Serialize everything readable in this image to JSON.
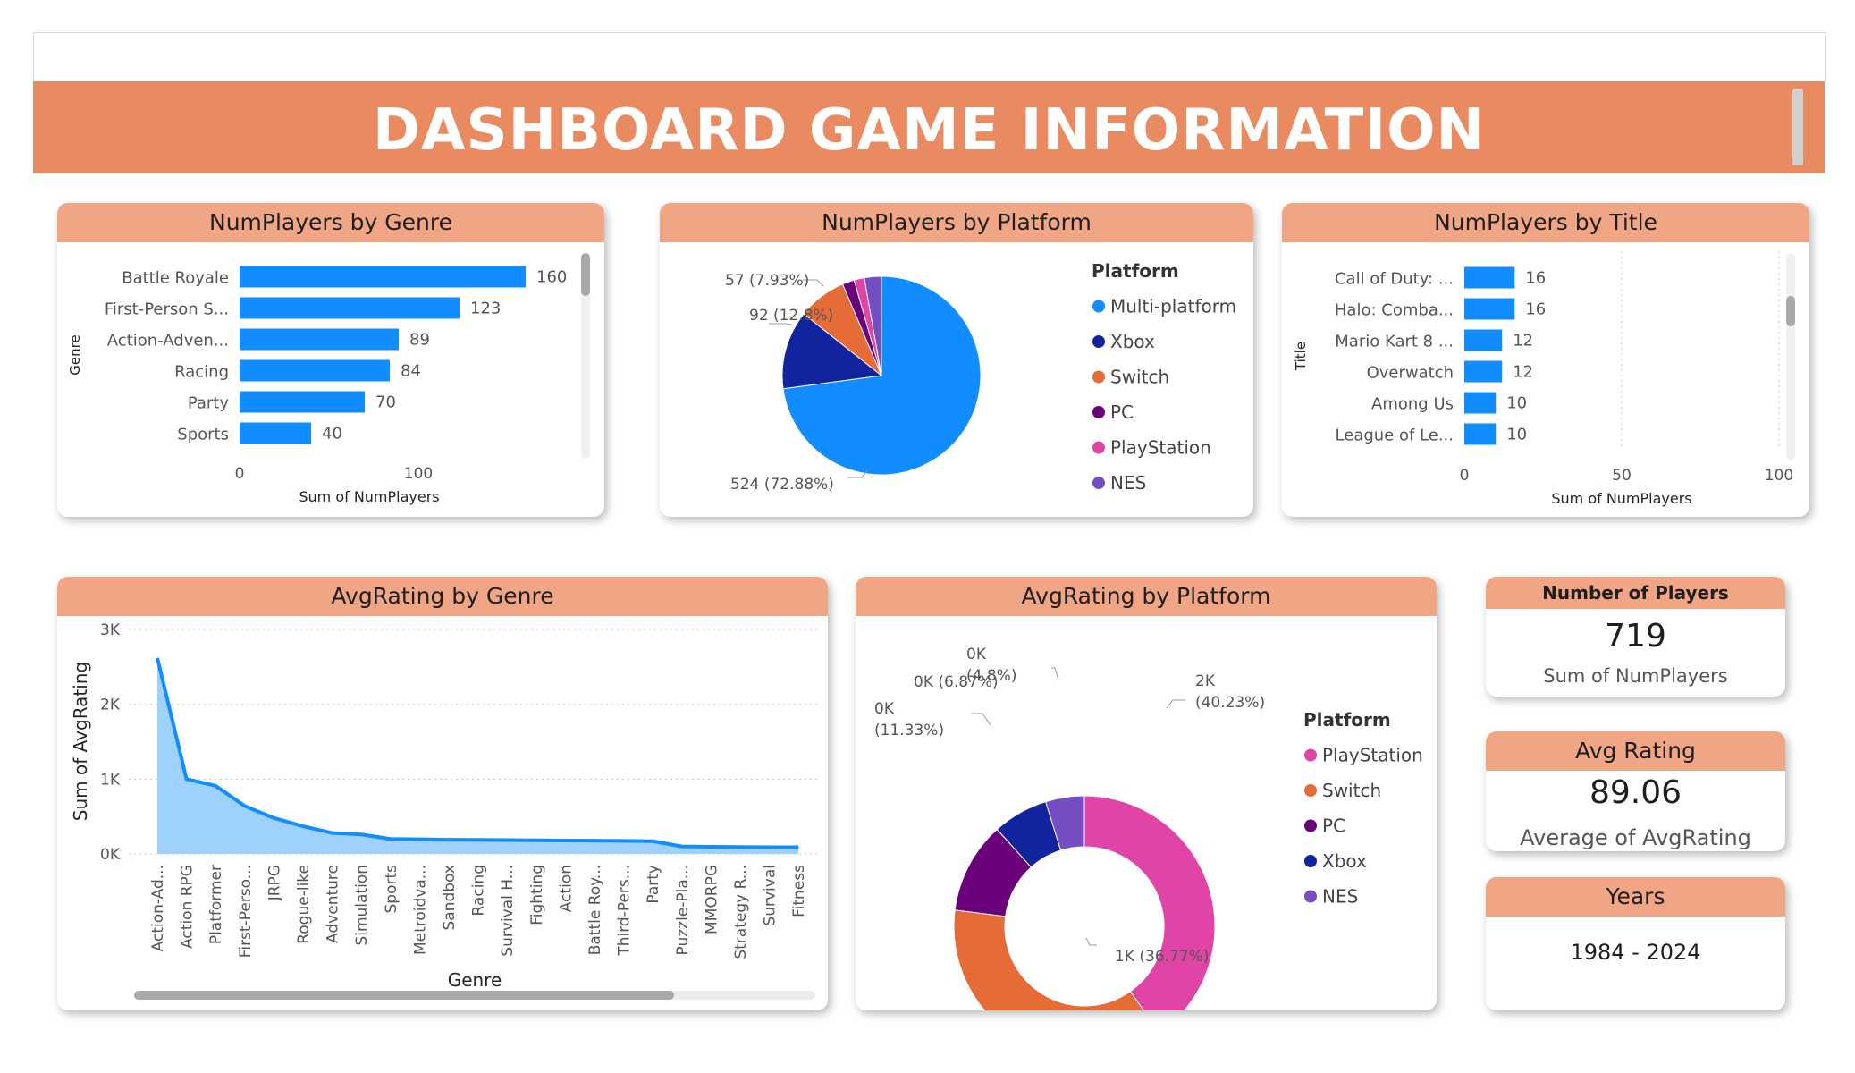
{
  "dashboard": {
    "title": "DASHBOARD GAME INFORMATION"
  },
  "colors": {
    "banner": "#e98a61",
    "card_header": "#f0a585",
    "bar": "#118dff"
  },
  "charts": {
    "genre_bar": {
      "title": "NumPlayers by Genre"
    },
    "platform_pie": {
      "title": "NumPlayers by Platform"
    },
    "title_bar": {
      "title": "NumPlayers by Title"
    },
    "genre_area": {
      "title": "AvgRating by Genre"
    },
    "platform_donut": {
      "title": "AvgRating by Platform"
    }
  },
  "kpis": {
    "players": {
      "title": "Number of Players",
      "value": "719",
      "label": "Sum of NumPlayers"
    },
    "rating": {
      "title": "Avg Rating",
      "value": "89.06",
      "label": "Average of AvgRating"
    },
    "years": {
      "title": "Years",
      "value": "1984 - 2024"
    }
  },
  "chart_data": [
    {
      "type": "bar",
      "orientation": "horizontal",
      "title": "NumPlayers by Genre",
      "categories": [
        "Battle Royale",
        "First-Person S...",
        "Action-Adven...",
        "Racing",
        "Party",
        "Sports"
      ],
      "values": [
        160,
        123,
        89,
        84,
        70,
        40
      ],
      "data_labels": [
        "160",
        "123",
        "89",
        "84",
        "70",
        "40"
      ],
      "xlabel": "Sum of NumPlayers",
      "ylabel": "Genre",
      "xlim": [
        0,
        190
      ],
      "x_ticks": [
        0,
        100
      ],
      "x_tick_labels": [
        "0",
        "100"
      ],
      "color": "#118dff"
    },
    {
      "type": "pie",
      "title": "NumPlayers by Platform",
      "legend_title": "Platform",
      "legend_position": "right",
      "labels": [
        "Multi-platform",
        "Xbox",
        "Switch",
        "PC",
        "PlayStation",
        "NES"
      ],
      "values": [
        524,
        92,
        57,
        14,
        12,
        20
      ],
      "colors": [
        "#118dff",
        "#12239e",
        "#e66c37",
        "#6b007b",
        "#e044a7",
        "#744ec2"
      ],
      "data_labels": [
        "524 (72.88%)",
        "92 (12.8%)",
        "57 (7.93%)",
        "",
        "",
        ""
      ]
    },
    {
      "type": "bar",
      "orientation": "horizontal",
      "title": "NumPlayers by Title",
      "categories": [
        "Call of Duty: ...",
        "Halo: Comba...",
        "Mario Kart 8 ...",
        "Overwatch",
        "Among Us",
        "League of Le..."
      ],
      "values": [
        16,
        16,
        12,
        12,
        10,
        10
      ],
      "data_labels": [
        "16",
        "16",
        "12",
        "12",
        "10",
        "10"
      ],
      "xlabel": "Sum of NumPlayers",
      "ylabel": "Title",
      "xlim": [
        0,
        100
      ],
      "x_ticks": [
        0,
        50,
        100
      ],
      "x_tick_labels": [
        "0",
        "50",
        "100"
      ],
      "color": "#118dff"
    },
    {
      "type": "area",
      "title": "AvgRating by Genre",
      "categories": [
        "Action-Ad...",
        "Action RPG",
        "Platformer",
        "First-Perso...",
        "JRPG",
        "Rogue-like",
        "Adventure",
        "Simulation",
        "Sports",
        "Metroidva...",
        "Sandbox",
        "Racing",
        "Survival H...",
        "Fighting",
        "Action",
        "Battle Roy...",
        "Third-Pers...",
        "Party",
        "Puzzle-Pla...",
        "MMORPG",
        "Strategy R...",
        "Survival",
        "Fitness"
      ],
      "values": [
        2620,
        1000,
        910,
        640,
        480,
        370,
        280,
        260,
        200,
        195,
        190,
        188,
        185,
        182,
        180,
        178,
        175,
        170,
        100,
        95,
        93,
        90,
        90
      ],
      "x_ticks_note": "category axis",
      "xlabel": "Genre",
      "ylabel": "Sum of AvgRating",
      "ylim": [
        0,
        3000
      ],
      "y_ticks": [
        0,
        1000,
        2000,
        3000
      ],
      "y_tick_labels": [
        "0K",
        "1K",
        "2K",
        "3K"
      ],
      "color": "#118dff"
    },
    {
      "type": "pie",
      "subtype": "donut",
      "title": "AvgRating by Platform",
      "legend_title": "Platform",
      "legend_position": "right",
      "labels": [
        "PlayStation",
        "Switch",
        "PC",
        "Xbox",
        "NES"
      ],
      "values": [
        40.23,
        36.77,
        11.33,
        6.87,
        4.8
      ],
      "colors": [
        "#e044a7",
        "#e66c37",
        "#6b007b",
        "#12239e",
        "#744ec2"
      ],
      "data_labels": [
        [
          "2K",
          "(40.23%)"
        ],
        [
          "1K (36.77%)"
        ],
        [
          "0K",
          "(11.33%)"
        ],
        [
          "0K (6.87%)"
        ],
        [
          "0K",
          "(4.8%)"
        ]
      ]
    }
  ]
}
